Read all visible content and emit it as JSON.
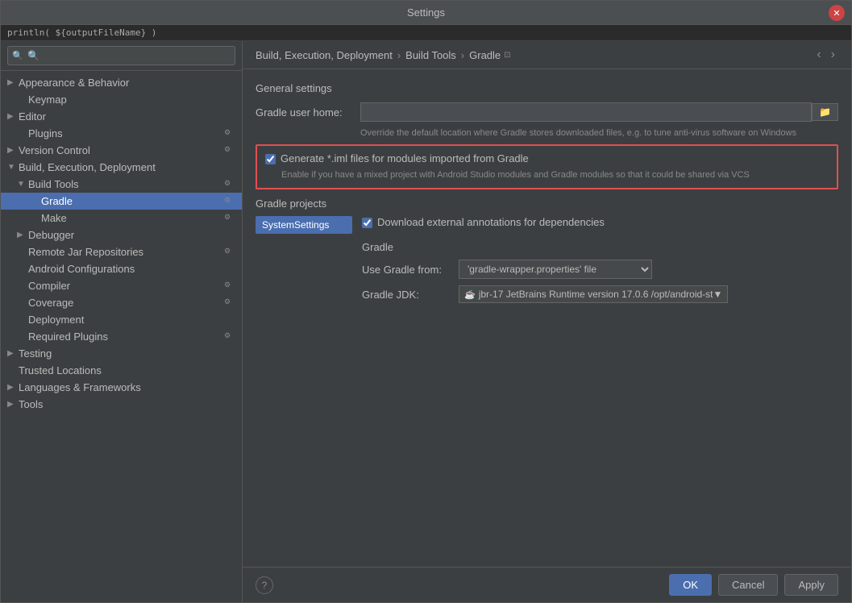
{
  "dialog": {
    "title": "Settings"
  },
  "header_code": "println( ${outputFileName} )",
  "search": {
    "placeholder": "🔍"
  },
  "sidebar": {
    "items": [
      {
        "id": "appearance",
        "label": "Appearance & Behavior",
        "level": 0,
        "has_arrow": true,
        "has_settings": false,
        "collapsed": true
      },
      {
        "id": "keymap",
        "label": "Keymap",
        "level": 1,
        "has_arrow": false,
        "has_settings": false
      },
      {
        "id": "editor",
        "label": "Editor",
        "level": 0,
        "has_arrow": true,
        "has_settings": false,
        "collapsed": true
      },
      {
        "id": "plugins",
        "label": "Plugins",
        "level": 1,
        "has_arrow": false,
        "has_settings": true
      },
      {
        "id": "version-control",
        "label": "Version Control",
        "level": 0,
        "has_arrow": true,
        "has_settings": true,
        "collapsed": true
      },
      {
        "id": "build-execution",
        "label": "Build, Execution, Deployment",
        "level": 0,
        "has_arrow": true,
        "has_settings": false,
        "collapsed": false
      },
      {
        "id": "build-tools",
        "label": "Build Tools",
        "level": 1,
        "has_arrow": true,
        "has_settings": true,
        "collapsed": false
      },
      {
        "id": "gradle",
        "label": "Gradle",
        "level": 2,
        "has_arrow": false,
        "has_settings": true,
        "selected": true
      },
      {
        "id": "make",
        "label": "Make",
        "level": 2,
        "has_arrow": false,
        "has_settings": true
      },
      {
        "id": "debugger",
        "label": "Debugger",
        "level": 1,
        "has_arrow": true,
        "has_settings": false,
        "collapsed": true
      },
      {
        "id": "remote-jar",
        "label": "Remote Jar Repositories",
        "level": 1,
        "has_arrow": false,
        "has_settings": true
      },
      {
        "id": "android-configs",
        "label": "Android Configurations",
        "level": 1,
        "has_arrow": false,
        "has_settings": false
      },
      {
        "id": "compiler",
        "label": "Compiler",
        "level": 1,
        "has_arrow": false,
        "has_settings": true
      },
      {
        "id": "coverage",
        "label": "Coverage",
        "level": 1,
        "has_arrow": false,
        "has_settings": true
      },
      {
        "id": "deployment",
        "label": "Deployment",
        "level": 1,
        "has_arrow": false,
        "has_settings": false
      },
      {
        "id": "required-plugins",
        "label": "Required Plugins",
        "level": 1,
        "has_arrow": false,
        "has_settings": true
      },
      {
        "id": "testing",
        "label": "Testing",
        "level": 0,
        "has_arrow": true,
        "has_settings": false,
        "collapsed": true
      },
      {
        "id": "trusted-locations",
        "label": "Trusted Locations",
        "level": 0,
        "has_arrow": false,
        "has_settings": false
      },
      {
        "id": "languages-frameworks",
        "label": "Languages & Frameworks",
        "level": 0,
        "has_arrow": true,
        "has_settings": false,
        "collapsed": true
      },
      {
        "id": "tools",
        "label": "Tools",
        "level": 0,
        "has_arrow": true,
        "has_settings": false,
        "collapsed": true
      }
    ]
  },
  "breadcrumb": {
    "path": [
      "Build, Execution, Deployment",
      "Build Tools",
      "Gradle"
    ],
    "separator": "›"
  },
  "main": {
    "general_settings": "General settings",
    "gradle_user_home_label": "Gradle user home:",
    "gradle_user_home_placeholder": "",
    "gradle_hint": "Override the default location where Gradle stores downloaded files, e.g. to tune anti-virus software on Windows",
    "generate_iml_label": "Generate *.iml files for modules imported from Gradle",
    "generate_iml_hint": "Enable if you have a mixed project with Android Studio modules and Gradle modules so that it could be shared via VCS",
    "generate_iml_checked": true,
    "gradle_projects_title": "Gradle projects",
    "system_settings_label": "SystemSettings",
    "download_annotations_label": "Download external annotations for dependencies",
    "download_annotations_checked": true,
    "gradle_section_title": "Gradle",
    "use_gradle_from_label": "Use Gradle from:",
    "use_gradle_from_value": "'gradle-wrapper.properties' file",
    "gradle_jdk_label": "Gradle JDK:",
    "gradle_jdk_value": "jbr-17  JetBrains Runtime version 17.0.6 /opt/android-st"
  },
  "buttons": {
    "ok": "OK",
    "cancel": "Cancel",
    "apply": "Apply",
    "help": "?"
  }
}
